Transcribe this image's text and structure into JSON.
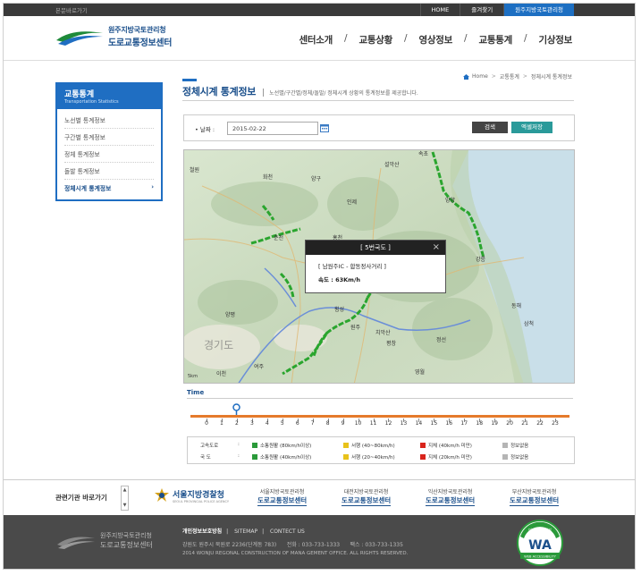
{
  "topbar": {
    "skip": "본문바로가기",
    "links": [
      "HOME",
      "즐겨찾기",
      "원주지방국토관리청"
    ]
  },
  "header": {
    "logo_line1": "원주지방국토관리청",
    "logo_line2": "도로교통정보센터",
    "nav": [
      "센터소개",
      "교통상황",
      "영상정보",
      "교통통계",
      "기상정보"
    ]
  },
  "lnb": {
    "title": "교통통계",
    "subtitle": "Transportation Statistics",
    "items": [
      "노선별 통계정보",
      "구간별 통계정보",
      "정체 통계정보",
      "돌발 통계정보",
      "정체시계 통계정보"
    ],
    "active_arrow": "›"
  },
  "breadcrumb": [
    "Home",
    "교통통계",
    "정체시계 통계정보"
  ],
  "page": {
    "title": "정체시계 통계정보",
    "description": "노선별/구간별/정체/돌발/ 정체시계 상황의 통계정보를 제공합니다."
  },
  "search": {
    "date_label": "• 날짜 :",
    "date_value": "2015-02-22",
    "search_button": "검색",
    "excel_button": "엑셀저장"
  },
  "map": {
    "popup_title": "[ 5번국도 ]",
    "popup_close": "×",
    "popup_section": "[ 남원주IC - 합동정사거리 ]",
    "popup_speed": "속도 : 63Km/h",
    "places": [
      "속초",
      "철원",
      "화천",
      "양구",
      "인제",
      "설악산",
      "양양",
      "춘천",
      "홍천",
      "강릉",
      "동해",
      "삼척",
      "횡성",
      "원주",
      "평창",
      "정선",
      "영월",
      "여주",
      "이천",
      "양평",
      "치악산",
      "경기도"
    ],
    "scale_label": "5km"
  },
  "time": {
    "label": "Time",
    "hours": [
      "0",
      "1",
      "2",
      "3",
      "4",
      "5",
      "6",
      "7",
      "8",
      "9",
      "10",
      "11",
      "12",
      "13",
      "14",
      "15",
      "16",
      "17",
      "18",
      "19",
      "20",
      "21",
      "22",
      "23"
    ],
    "selected_hour": 2
  },
  "legend": {
    "rows": [
      {
        "category": "고속도로",
        "colon": ":",
        "items": [
          {
            "label": "소통원활 (80km/h이상)",
            "color": "#2a9a3a"
          },
          {
            "label": "서행 (40~80km/h)",
            "color": "#e8c21a"
          },
          {
            "label": "지체 (40km/h 미만)",
            "color": "#d9241c"
          },
          {
            "label": "정보없음",
            "color": "#b5b5b5"
          }
        ]
      },
      {
        "category": "국    도",
        "colon": ":",
        "items": [
          {
            "label": "소통원활 (40km/h이상)",
            "color": "#2a9a3a"
          },
          {
            "label": "서행 (20~40km/h)",
            "color": "#e8c21a"
          },
          {
            "label": "지체 (20km/h 미만)",
            "color": "#d9241c"
          },
          {
            "label": "정보없음",
            "color": "#b5b5b5"
          }
        ]
      }
    ]
  },
  "related": {
    "title": "관련기관 바로가기",
    "arrows": "▲\n▼",
    "police_name": "서울지방경찰청",
    "police_sub": "SEOUL PROVINCIAL POLICE AGENCY",
    "orgs": [
      {
        "line1": "서울지방국토관리청",
        "line2": "도로교통정보센터"
      },
      {
        "line1": "대전지방국토관리청",
        "line2": "도로교통정보센터"
      },
      {
        "line1": "익산지방국토관리청",
        "line2": "도로교통정보센터"
      },
      {
        "line1": "부산지방국토관리청",
        "line2": "도로교통정보센터"
      }
    ]
  },
  "footer": {
    "logo_line1": "원주지방국토관리청",
    "logo_line2": "도로교통정보센터",
    "links": [
      "개인정보보호방침",
      "SITEMAP",
      "CONTECT US"
    ],
    "address": "강원도 원주시 북원로 2236(단계동 783)      전화 : 033-733-1333      팩스 : 033-733-1335",
    "copyright": "2014 WONJU REGONAL CONSTRUCTION OF MANA GEMENT OFFICE. ALL RIGHTS RESERVED.",
    "badge_top": "미래창조과학부",
    "badge_mark": "WA",
    "badge_bottom": "WEB ACCESSIBILITY"
  }
}
